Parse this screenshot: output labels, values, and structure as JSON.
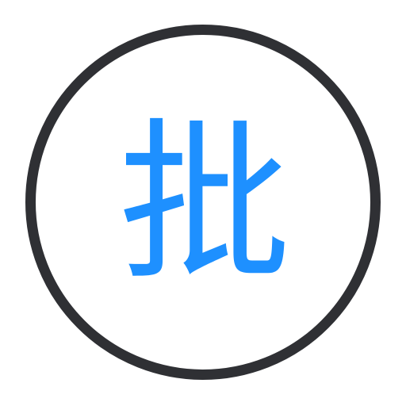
{
  "badge": {
    "character": "批",
    "ring_color": "#2f3034",
    "character_color": "#1e90ff",
    "background_color": "#ffffff"
  }
}
